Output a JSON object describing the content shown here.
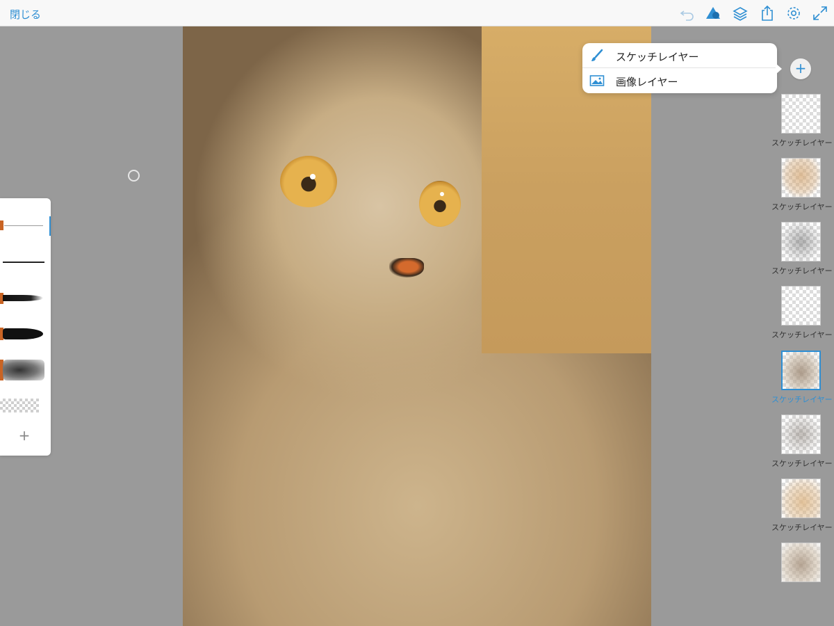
{
  "topbar": {
    "close_label": "閉じる",
    "icons": [
      "undo-icon",
      "shapes-icon",
      "layers-icon",
      "share-icon",
      "settings-icon",
      "fullscreen-icon"
    ]
  },
  "colors": {
    "accent": "#2f8fd3",
    "brush_color": "#c96424",
    "background": "#9a9a9a"
  },
  "brushes": [
    {
      "name": "fine-pencil",
      "selected": true
    },
    {
      "name": "pen"
    },
    {
      "name": "ink-brush"
    },
    {
      "name": "marker"
    },
    {
      "name": "airbrush"
    },
    {
      "name": "eraser"
    }
  ],
  "add_layer_menu": {
    "items": [
      {
        "label": "スケッチレイヤー",
        "icon": "brush-icon"
      },
      {
        "label": "画像レイヤー",
        "icon": "image-icon"
      }
    ]
  },
  "add_layer_button": "+",
  "add_brush_button": "+",
  "layers": [
    {
      "name": "スケッチレイヤー",
      "selected": false
    },
    {
      "name": "スケッチレイヤー",
      "selected": false
    },
    {
      "name": "スケッチレイヤー",
      "selected": false
    },
    {
      "name": "スケッチレイヤー",
      "selected": false
    },
    {
      "name": "スケッチレイヤー",
      "selected": true
    },
    {
      "name": "スケッチレイヤー",
      "selected": false
    },
    {
      "name": "スケッチレイヤー",
      "selected": false
    },
    {
      "name": "",
      "selected": false
    }
  ]
}
